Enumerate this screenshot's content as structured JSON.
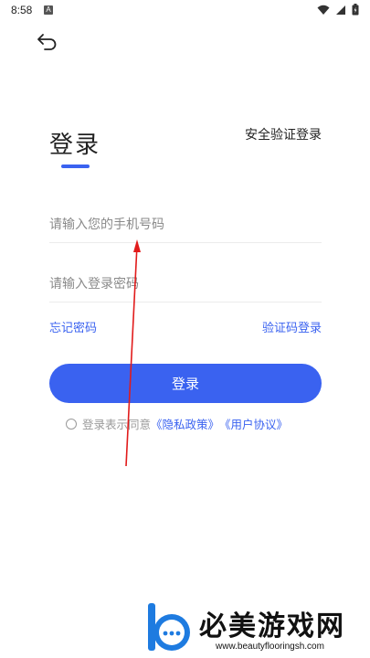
{
  "status_bar": {
    "time": "8:58",
    "notification_badge": "A",
    "icons": [
      "wifi-icon",
      "signal-icon",
      "battery-icon"
    ]
  },
  "header": {
    "back_icon": "back-arrow-icon"
  },
  "login": {
    "title": "登录",
    "secure_login_label": "安全验证登录",
    "phone_placeholder": "请输入您的手机号码",
    "password_placeholder": "请输入登录密码",
    "forgot_password_label": "忘记密码",
    "code_login_label": "验证码登录",
    "submit_label": "登录",
    "agreement_prefix": "登录表示同意",
    "privacy_policy_label": "《隐私政策》",
    "user_agreement_label": "《用户协议》",
    "agreement_checked": false
  },
  "watermark": {
    "name": "必美游戏网",
    "url": "www.beautyflooringsh.com"
  },
  "colors": {
    "accent": "#3a62f0",
    "annotation": "#e11b1b",
    "text": "#222222",
    "placeholder": "#8a8a8a"
  }
}
